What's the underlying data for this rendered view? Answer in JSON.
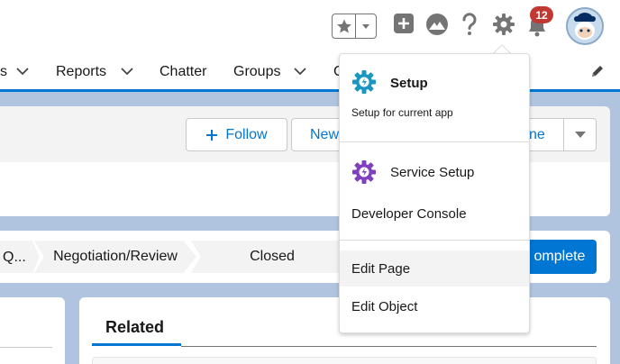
{
  "header": {
    "notification_count": "12",
    "icons": [
      "star-icon",
      "chevron-down-icon",
      "plus-icon",
      "trailhead-icon",
      "help-icon",
      "gear-icon",
      "bell-icon",
      "avatar"
    ]
  },
  "nav": {
    "items": [
      {
        "label": "s",
        "has_menu": true
      },
      {
        "label": "Reports",
        "has_menu": true
      },
      {
        "label": "Chatter",
        "has_menu": false
      },
      {
        "label": "Groups",
        "has_menu": true
      },
      {
        "label": "C",
        "has_menu": false
      }
    ]
  },
  "record": {
    "follow_label": "Follow",
    "new_label": "New",
    "ne_label": "ne"
  },
  "path": {
    "stages": [
      "Q...",
      "Negotiation/Review",
      "Closed"
    ],
    "complete_label": "omplete"
  },
  "related": {
    "tab_label": "Related"
  },
  "setup_menu": {
    "setup_title": "Setup",
    "setup_subtitle": "Setup for current app",
    "service_setup": "Service Setup",
    "developer_console": "Developer Console",
    "edit_page": "Edit Page",
    "edit_object": "Edit Object"
  },
  "colors": {
    "brand_blue": "#0176d3",
    "setup_gear": "#1b96c1",
    "service_gear": "#7f3fbf",
    "badge_red": "#c23934"
  }
}
